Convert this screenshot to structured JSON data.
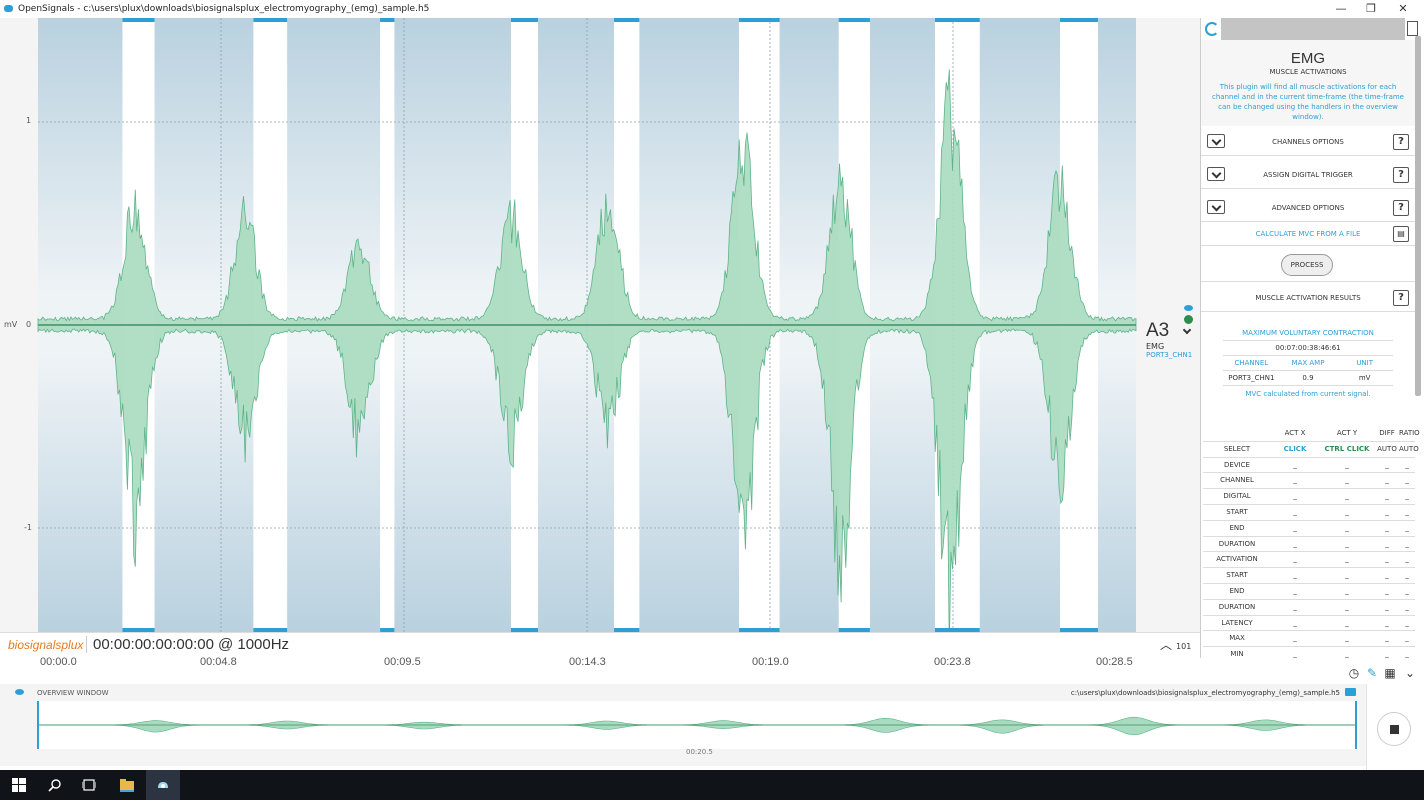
{
  "window": {
    "title": "OpenSignals - c:\\users\\plux\\downloads\\biosignalsplux_electromyography_(emg)_sample.h5",
    "controls": [
      "—",
      "❐",
      "✕"
    ]
  },
  "plot": {
    "y_unit": "mV",
    "y_ticks": [
      "1",
      "0",
      "-1"
    ],
    "channel": {
      "name": "A3",
      "type": "EMG",
      "port": "PORT3_CHN1"
    },
    "x_ticks": [
      "00:00.0",
      "00:04.8",
      "00:09.5",
      "00:14.3",
      "00:19.0",
      "00:23.8",
      "00:28.5"
    ],
    "activations": [
      [
        1.0,
        1.38
      ],
      [
        2.55,
        2.95
      ],
      [
        4.05,
        4.22
      ],
      [
        5.6,
        5.92
      ],
      [
        6.82,
        7.12
      ],
      [
        8.3,
        8.78
      ],
      [
        9.48,
        9.85
      ],
      [
        10.62,
        11.15
      ],
      [
        12.1,
        12.55
      ]
    ],
    "bursts": [
      [
        1.15,
        0.55,
        0.9
      ],
      [
        2.45,
        0.5,
        0.5
      ],
      [
        3.8,
        0.35,
        0.5
      ],
      [
        5.6,
        0.5,
        0.55
      ],
      [
        6.75,
        0.55,
        0.45
      ],
      [
        8.35,
        0.85,
        0.95
      ],
      [
        9.5,
        0.65,
        1.05
      ],
      [
        10.8,
        1.0,
        1.25
      ],
      [
        12.1,
        0.65,
        0.7
      ]
    ],
    "x_max": 13.0,
    "colors": {
      "burst_fill": "#a8dbbf",
      "burst_line": "#5fb389",
      "band": "#b8d0dd",
      "marker": "#2c9fd4"
    }
  },
  "timebar": {
    "logo": "biosignalsplux",
    "timecode": "00:00:00:00:00:00",
    "rate": "@ 1000Hz",
    "zoom_value": "101"
  },
  "overview": {
    "title": "OVERVIEW WINDOW",
    "path": "c:\\users\\plux\\downloads\\biosignalsplux_electromyography_(emg)_sample.h5",
    "time": "00:20.5"
  },
  "panel": {
    "title": "EMG",
    "subtitle": "MUSCLE ACTIVATIONS",
    "description": "This plugin will find all muscle activations for each channel and in the current time-frame (the time-frame can be changed using the handlers in the overview window).",
    "channels_options": "CHANNELS OPTIONS",
    "assign_trigger": "ASSIGN DIGITAL TRIGGER",
    "advanced_options": "ADVANCED OPTIONS",
    "calc_mvc": "CALCULATE MVC FROM A FILE",
    "process": "PROCESS",
    "results": "MUSCLE ACTIVATION RESULTS",
    "help": "?",
    "mvc": {
      "title": "MAXIMUM VOLUNTARY CONTRACTION",
      "time": "00:07:00:38:46:61",
      "headers": [
        "CHANNEL",
        "MAX AMP",
        "UNIT"
      ],
      "row": [
        "PORT3_CHN1",
        "0.9",
        "mV"
      ],
      "note": "MVC calculated from current signal."
    },
    "table": {
      "headers": [
        "",
        "ACT X",
        "ACT Y",
        "DIFF",
        "RATIO"
      ],
      "select": [
        "SELECT",
        "CLICK",
        "CTRL CLICK",
        "AUTO",
        "AUTO"
      ],
      "rows": [
        "DEVICE",
        "CHANNEL",
        "DIGITAL",
        "START",
        "END",
        "DURATION",
        "ACTIVATION",
        "START",
        "END",
        "DURATION",
        "LATENCY",
        "MAX",
        "MIN"
      ],
      "empty": "_"
    }
  }
}
